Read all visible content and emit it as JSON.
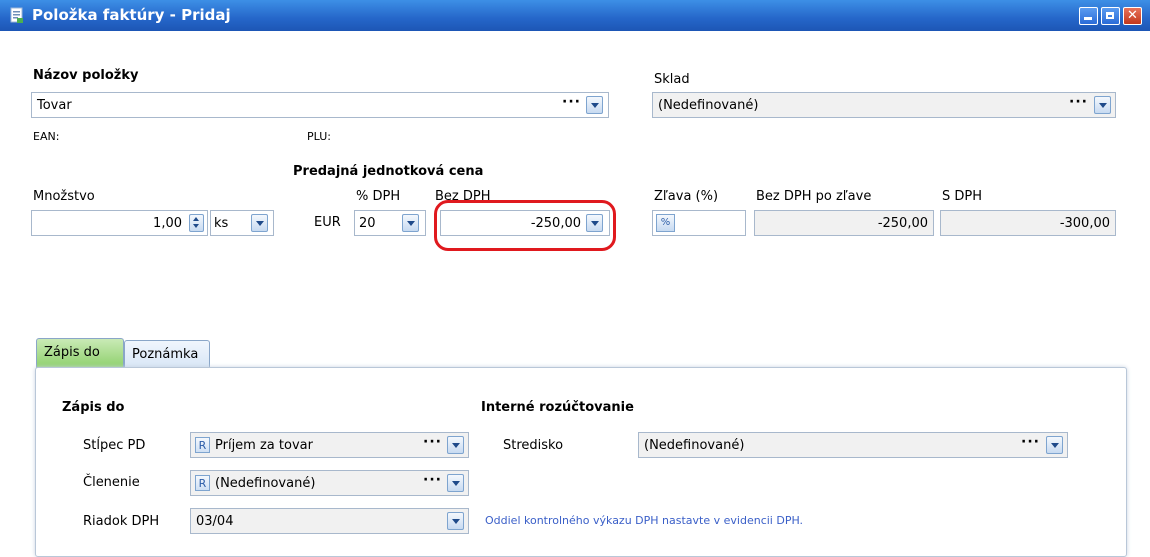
{
  "window": {
    "title": "Položka faktúry - Pridaj",
    "close_glyph": "✕"
  },
  "item": {
    "name_label": "Názov položky",
    "name_value": "Tovar",
    "ean_label": "EAN:",
    "plu_label": "PLU:",
    "stock_label": "Sklad",
    "stock_value": "(Nedefinované)"
  },
  "pricing": {
    "section_label": "Predajná jednotková cena",
    "quantity_label": "Množstvo",
    "quantity_value": "1,00",
    "unit_value": "ks",
    "currency": "EUR",
    "vat_pct_label": "% DPH",
    "vat_pct_value": "20",
    "net_label": "Bez DPH",
    "net_value": "-250,00",
    "discount_label": "Zľava (%)",
    "discount_button": "%",
    "discount_value": "",
    "net_after_discount_label": "Bez DPH po zľave",
    "net_after_discount_value": "-250,00",
    "gross_label": "S DPH",
    "gross_value": "-300,00"
  },
  "tabs": [
    {
      "label": "Zápis do",
      "active": true
    },
    {
      "label": "Poznámka",
      "active": false
    }
  ],
  "entry": {
    "section_label": "Zápis do",
    "column_label": "Stĺpec PD",
    "column_badge": "R",
    "column_value": "Príjem za tovar",
    "breakdown_label": "Členenie",
    "breakdown_badge": "R",
    "breakdown_value": "(Nedefinované)",
    "vat_row_label": "Riadok DPH",
    "vat_row_value": "03/04",
    "vat_note": "Oddiel kontrolného výkazu DPH nastavte v evidencii DPH."
  },
  "internal": {
    "section_label": "Interné rozúčtovanie",
    "center_label": "Stredisko",
    "center_value": "(Nedefinované)"
  },
  "colors": {
    "titlebar": "#2566c9",
    "active_tab": "#8ed06b",
    "highlight": "#e0191e",
    "link": "#3a5fc8"
  }
}
